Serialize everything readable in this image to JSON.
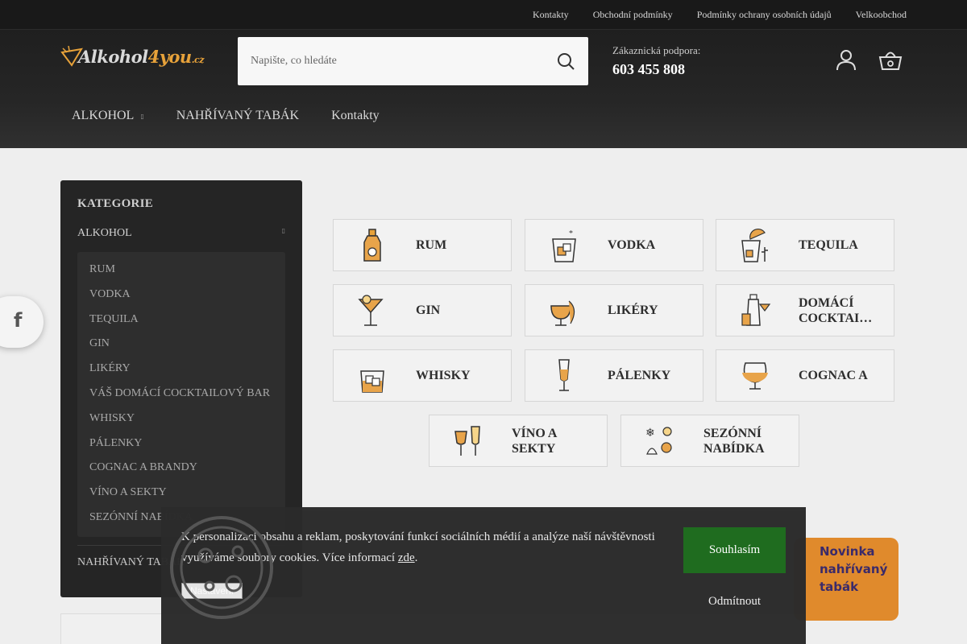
{
  "colors": {
    "accent": "#e7a23a",
    "accept": "#1b6a1b",
    "banner": "#e08a2c"
  },
  "top_links": [
    "Kontakty",
    "Obchodní podmínky",
    "Podmínky ochrany osobních údajů",
    "Velkoobchod"
  ],
  "logo": {
    "main": "Alkohol",
    "four": "4you",
    "tld": ".cz"
  },
  "search": {
    "placeholder": "Napište, co hledáte",
    "icon": "search-icon"
  },
  "support": {
    "label": "Zákaznická podpora:",
    "phone": "603 455 808"
  },
  "header_icons": [
    "user-icon",
    "basket-icon"
  ],
  "nav": [
    {
      "label": "ALKOHOL",
      "has_submenu": true
    },
    {
      "label": "NAHŘÍVANÝ TABÁK"
    },
    {
      "label": "Kontakty"
    }
  ],
  "sidebar": {
    "title": "KATEGORIE",
    "alkohol": "ALKOHOL",
    "items": [
      "RUM",
      "VODKA",
      "TEQUILA",
      "GIN",
      "LIKÉRY",
      "VÁŠ DOMÁCÍ COCKTAILOVÝ BAR",
      "WHISKY",
      "PÁLENKY",
      "COGNAC A BRANDY",
      "VÍNO A SEKTY",
      "SEZÓNNÍ NABÍDKA"
    ],
    "nahrivany": "NAHŘÍVANÝ TABÁK"
  },
  "facebook": {
    "glyph": "f",
    "icon": "facebook-icon"
  },
  "categories": [
    {
      "label": "RUM",
      "icon": "rum-bottle-icon"
    },
    {
      "label": "VODKA",
      "icon": "vodka-glass-icon"
    },
    {
      "label": "TEQUILA",
      "icon": "tequila-icon"
    },
    {
      "label": "GIN",
      "icon": "gin-cocktail-icon"
    },
    {
      "label": "LIKÉRY",
      "icon": "liqueur-icon"
    },
    {
      "label": "DOMÁCÍ COCKTAILOVÝ BAR",
      "icon": "cocktail-shaker-icon"
    },
    {
      "label": "WHISKY",
      "icon": "whisky-glass-icon"
    },
    {
      "label": "PÁLENKY",
      "icon": "palenka-glass-icon"
    },
    {
      "label": "COGNAC A",
      "icon": "cognac-glass-icon"
    },
    {
      "label": "VÍNO A SEKTY",
      "icon": "wine-glasses-icon"
    },
    {
      "label": "SEZÓNNÍ NABÍDKA",
      "icon": "seasonal-icon"
    }
  ],
  "banner": {
    "line1": "Novinka",
    "line2": "nahřívaný",
    "line3": "tabák"
  },
  "cookie": {
    "text_before": "K personalizaci obsahu a reklam, poskytování funkcí sociálních médií a analýze naší návštěvnosti využíváme soubory cookies. Více informací ",
    "link": "zde",
    "text_after": ".",
    "settings": "Nastavení",
    "accept": "Souhlasím",
    "decline": "Odmítnout"
  }
}
